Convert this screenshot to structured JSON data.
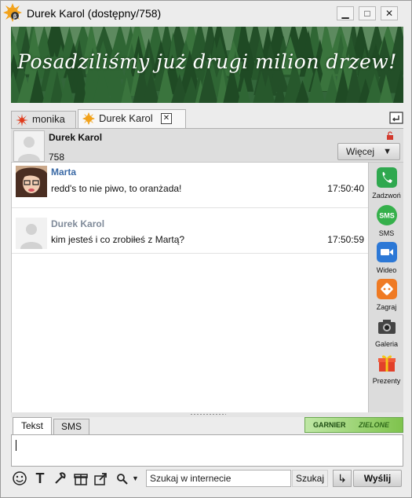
{
  "window": {
    "title": "Durek Karol (dostępny/758)",
    "controls": [
      "minimize",
      "maximize",
      "close"
    ]
  },
  "banner": {
    "text": "Posadziliśmy już drugi milion drzew!"
  },
  "tabs": [
    {
      "label": "monika",
      "active": false,
      "icon": "burst-status-icon"
    },
    {
      "label": "Durek Karol",
      "active": true,
      "icon": "sun-status-icon"
    }
  ],
  "contact": {
    "name": "Durek Karol",
    "number": "758",
    "more_label": "Więcej"
  },
  "messages": [
    {
      "author": "Marta",
      "text": "redd's to nie piwo, to oranżada!",
      "time": "17:50:40",
      "author_color": "#3b6aa6"
    },
    {
      "author": "Durek Karol",
      "text": "kim jesteś i co zrobiłeś z Martą?",
      "time": "17:50:59",
      "author_color": "#7f8a99"
    }
  ],
  "actions": [
    {
      "label": "Zadzwoń",
      "icon": "phone-icon",
      "color": "#2fa84f"
    },
    {
      "label": "SMS",
      "icon": "sms-icon",
      "color": "#35b04b"
    },
    {
      "label": "Wideo",
      "icon": "video-icon",
      "color": "#2c78d6"
    },
    {
      "label": "Zagraj",
      "icon": "game-icon",
      "color": "#ef7a23"
    },
    {
      "label": "Galeria",
      "icon": "camera-icon",
      "color": "#444444"
    },
    {
      "label": "Prezenty",
      "icon": "gift-icon",
      "color": "#e2402a"
    }
  ],
  "compose": {
    "tabs": [
      {
        "label": "Tekst",
        "active": true
      },
      {
        "label": "SMS",
        "active": false
      }
    ],
    "value": ""
  },
  "ad": {
    "brand": "GARNIER",
    "slogan": "ZIELONE LATO"
  },
  "toolbar": {
    "search_value": "Szukaj w internecie",
    "search_button": "Szukaj",
    "send_label": "Wyślij"
  }
}
